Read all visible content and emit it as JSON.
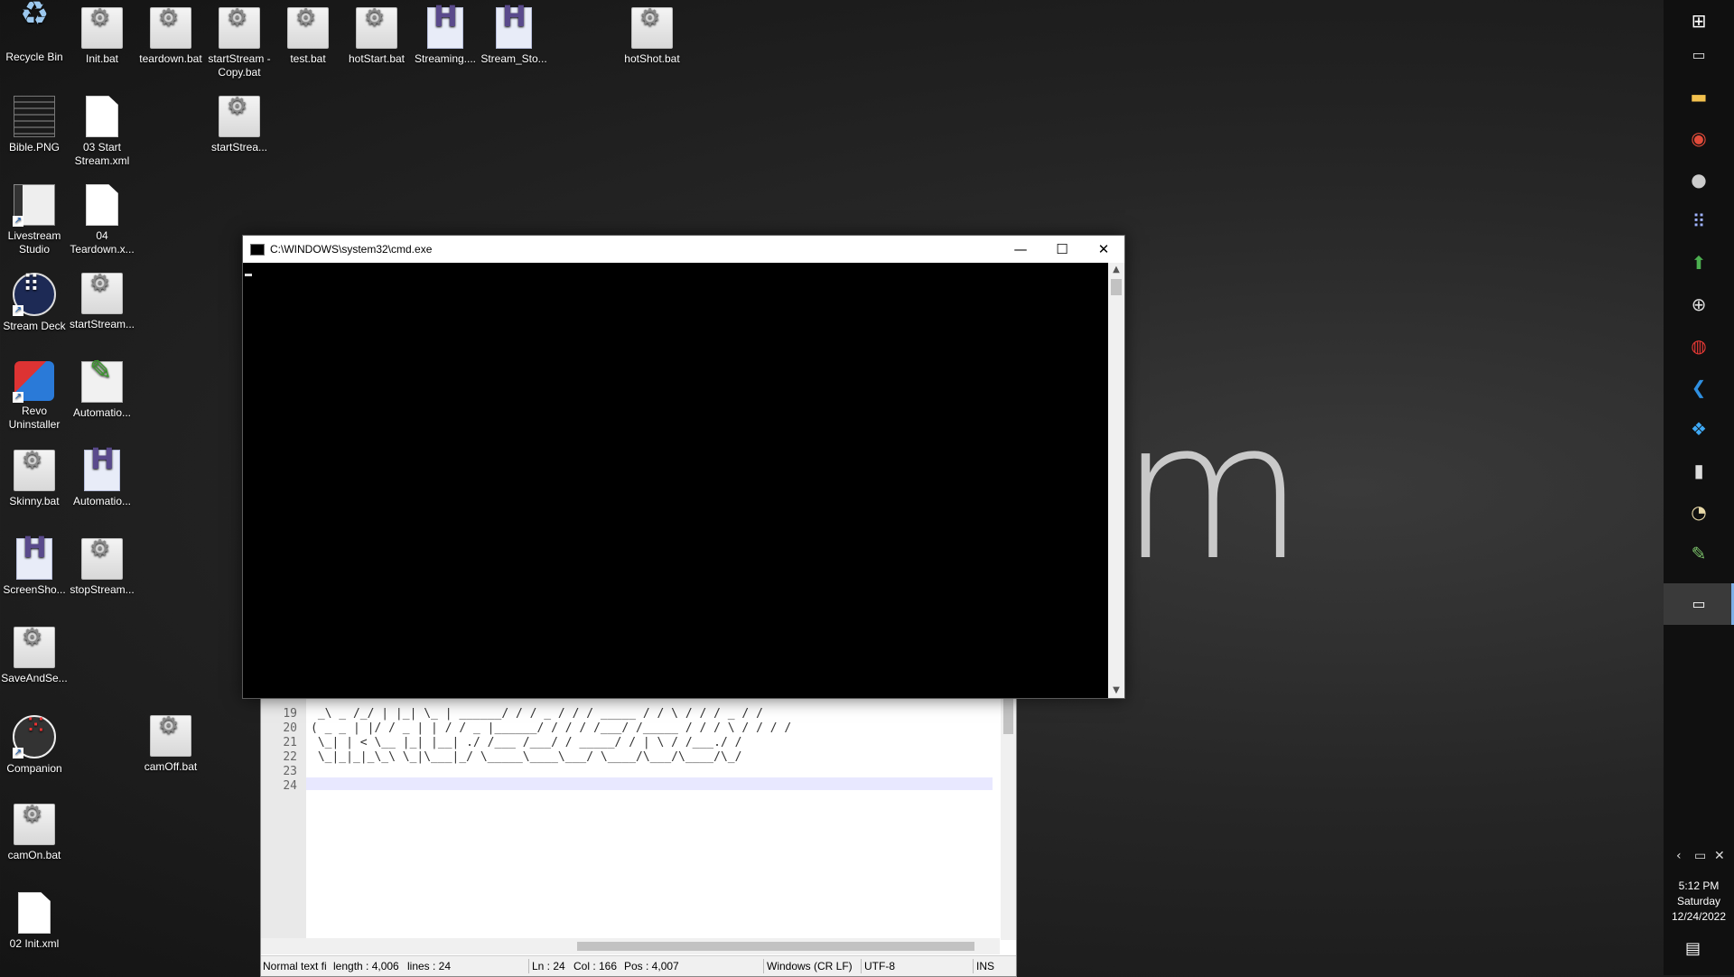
{
  "wallpaper": {
    "text": "m"
  },
  "desktop_icons": [
    {
      "label": "Recycle Bin"
    },
    {
      "label": "Init.bat"
    },
    {
      "label": "teardown.bat"
    },
    {
      "label": "startStream - Copy.bat"
    },
    {
      "label": "test.bat"
    },
    {
      "label": "hotStart.bat"
    },
    {
      "label": "Streaming...."
    },
    {
      "label": "Stream_Sto..."
    },
    {
      "label": "hotShot.bat"
    },
    {
      "label": "Bible.PNG"
    },
    {
      "label": "03 Start Stream.xml"
    },
    {
      "label": "startStrea..."
    },
    {
      "label": "Livestream Studio"
    },
    {
      "label": "04 Teardown.x..."
    },
    {
      "label": "Stream Deck"
    },
    {
      "label": "startStream..."
    },
    {
      "label": "Revo Uninstaller"
    },
    {
      "label": "Automatio..."
    },
    {
      "label": "Skinny.bat"
    },
    {
      "label": "Automatio..."
    },
    {
      "label": "ScreenSho..."
    },
    {
      "label": "stopStream..."
    },
    {
      "label": "SaveAndSe..."
    },
    {
      "label": "Companion"
    },
    {
      "label": "camOff.bat"
    },
    {
      "label": "camOn.bat"
    },
    {
      "label": "02 Init.xml"
    }
  ],
  "editor": {
    "line_numbers": [
      "19",
      "20",
      "21",
      "22",
      "23",
      "24"
    ],
    "lines": [
      " _\\ _ /_/ | |_| \\_ | ______/ / / _ / / / _____ / / \\ / / / _ / / ",
      "( _ _ | |/ / _ | | / / _ |______/ / / / /___/ /_____ / / / \\ / / / / ",
      " \\_| | < \\__ |_| |__| ./ /___ /___/ / _____/ / | \\ / /___./ / ",
      " \\_|_|_|_\\_\\ \\_|\\___|_/ \\_____\\____\\___/ \\____/\\___/\\____/\\_/ ",
      "",
      ""
    ],
    "status": {
      "type": "Normal text fi",
      "length": "length : 4,006",
      "lines": "lines : 24",
      "ln": "Ln : 24",
      "col": "Col : 166",
      "pos": "Pos : 4,007",
      "eol": "Windows (CR LF)",
      "encoding": "UTF-8",
      "mode": "INS"
    }
  },
  "cmd": {
    "title": "C:\\WINDOWS\\system32\\cmd.exe",
    "minimize": "—",
    "maximize": "☐",
    "close": "✕"
  },
  "taskbar": {
    "icons": [
      "windows-icon",
      "task-view-icon",
      "file-explorer-icon",
      "chrome-icon",
      "obs-icon",
      "stream-deck-icon",
      "upload-icon",
      "network-icon",
      "record-icon",
      "vscode-icon",
      "dropbox-icon",
      "livestream-icon",
      "clock-app-icon",
      "automation-icon",
      "cmd-icon"
    ],
    "clock": {
      "time": "5:12 PM",
      "day": "Saturday",
      "date": "12/24/2022"
    }
  },
  "colors": {
    "taskbar": "#101010",
    "cmd_bg": "#000000",
    "active_task": "#3a3a3a"
  }
}
